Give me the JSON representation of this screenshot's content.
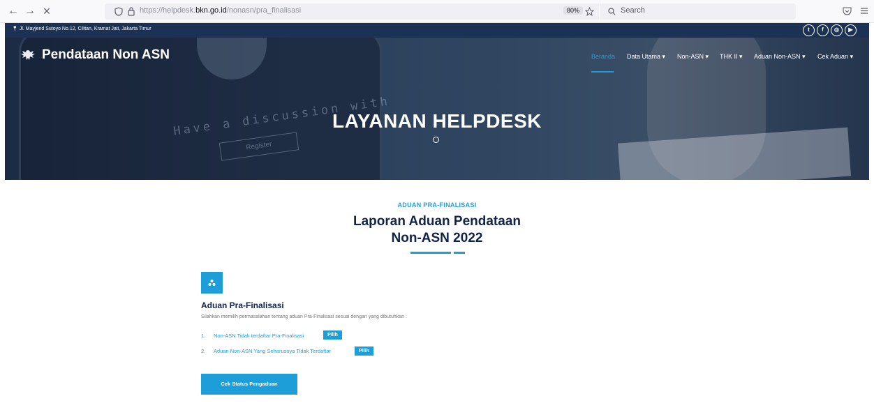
{
  "browser": {
    "back_icon": "←",
    "forward_icon": "→",
    "close_icon": "×",
    "url_prefix": "https://helpdesk.",
    "url_domain": "bkn.go.id",
    "url_path": "/nonasn/pra_finalisasi",
    "zoom": "80%",
    "search_placeholder": "Search"
  },
  "topbar": {
    "address": "Jl. Mayjend Sutoyo No.12, Cilitan, Kramat Jati, Jakarta Timur",
    "social": [
      "twitter-icon",
      "facebook-icon",
      "instagram-icon",
      "youtube-icon"
    ]
  },
  "navbar": {
    "brand": "Pendataan Non ASN",
    "menu": [
      "Beranda",
      "Data Utama",
      "Non-ASN",
      "THK II",
      "Aduan Non-ASN",
      "Cek Aduan"
    ],
    "active": "Beranda"
  },
  "hero": {
    "title": "LAYANAN HELPDESK",
    "bg_discussion": "Have a discussion with",
    "bg_register": "Register"
  },
  "content": {
    "eyebrow": "ADUAN PRA-FINALISASI",
    "title_line1": "Laporan Aduan Pendataan",
    "title_line2": "Non-ASN 2022",
    "section_heading": "Aduan Pra-Finalisasi",
    "section_desc": "Silahkan memilih permasalahan tentang aduan Pra-Finalisasi sesuai dengan yang dibutuhkan :",
    "options": [
      {
        "num": "1.",
        "label": "Non-ASN Tidak terdaftar Pra-Finalisasi",
        "button": "Pilih"
      },
      {
        "num": "2.",
        "label": "Aduan Non-ASN Yang Seharusnya Tidak Terdaftar",
        "button": "Pilih"
      }
    ],
    "check_button": "Cek Status Pengaduan"
  },
  "colors": {
    "accent": "#1e9ed9",
    "navy": "#10234a",
    "topbar": "#1c3255"
  }
}
